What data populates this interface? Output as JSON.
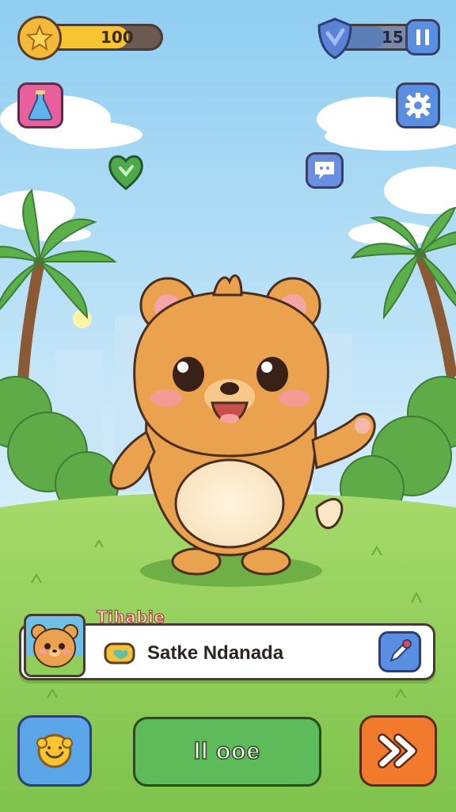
{
  "hud": {
    "coins_value": "100",
    "coins_fill_fraction": 0.72,
    "level_value": "15",
    "level_fill_fraction": 0.55
  },
  "icons": {
    "coin": "star-coin-icon",
    "shield": "shield-icon",
    "pause": "pause-icon",
    "potion": "potion-icon",
    "settings": "gear-icon",
    "heart": "heart-icon",
    "chat": "chat-icon",
    "pet_avatar": "bear-avatar-icon",
    "tag": "tag-icon",
    "edit": "pencil-icon",
    "emote": "smile-icon",
    "next": "double-arrow-icon"
  },
  "pet": {
    "tag_label": "Tihabie",
    "name": "Satke Ndanada"
  },
  "buttons": {
    "main_label": "ll ooe"
  },
  "colors": {
    "sky_top": "#9fd6f4",
    "grass": "#8fcf59",
    "bear": "#eba24f",
    "coin_bar": "#f7c531",
    "level_bar": "#5d7fb8",
    "main_button": "#5dbb5a",
    "next_button": "#f27a2c",
    "emote_button": "#5aa6e8"
  }
}
